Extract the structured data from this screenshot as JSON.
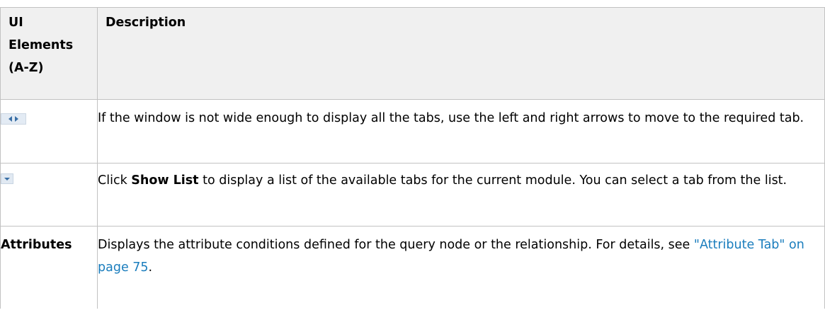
{
  "table": {
    "header": {
      "col1": [
        "UI",
        "Elements",
        "(A-Z)"
      ],
      "col2": "Description"
    },
    "rows": [
      {
        "element_icon": "left-right-arrows-icon",
        "description": "If the window is not wide enough to display all the tabs, use the left and right arrows to move to the required tab."
      },
      {
        "element_icon": "show-list-dropdown-icon",
        "desc_pre": "Click ",
        "desc_bold": "Show List",
        "desc_post": " to display a list of the available tabs for the current module. You can select a tab from the list."
      },
      {
        "element": "Attributes",
        "desc_pre": "Displays the attribute conditions defined for the query node or the relationship. For details, see ",
        "desc_link": "\"Attribute Tab\" on page 75",
        "desc_post": "."
      }
    ]
  },
  "colors": {
    "link": "#1a7dbd",
    "header_bg": "#f0f0f0",
    "border": "#c2c2c2"
  }
}
